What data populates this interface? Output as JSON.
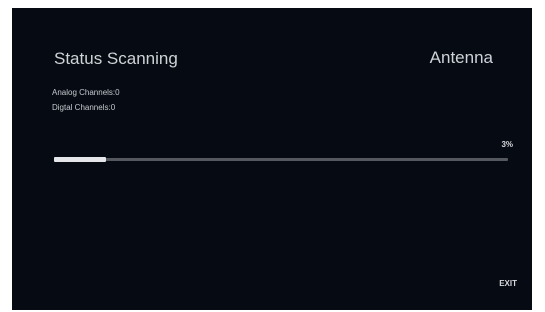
{
  "header": {
    "title": "Status Scanning",
    "source": "Antenna"
  },
  "channels": {
    "analog": "Analog Channels:0",
    "digital": "Digtal Channels:0"
  },
  "progress": {
    "percent_label": "3%",
    "value": 0.03
  },
  "footer": {
    "exit_label": "EXIT"
  },
  "colors": {
    "background": "#060a12",
    "track": "#55595f",
    "fill": "#e4e6e9"
  }
}
